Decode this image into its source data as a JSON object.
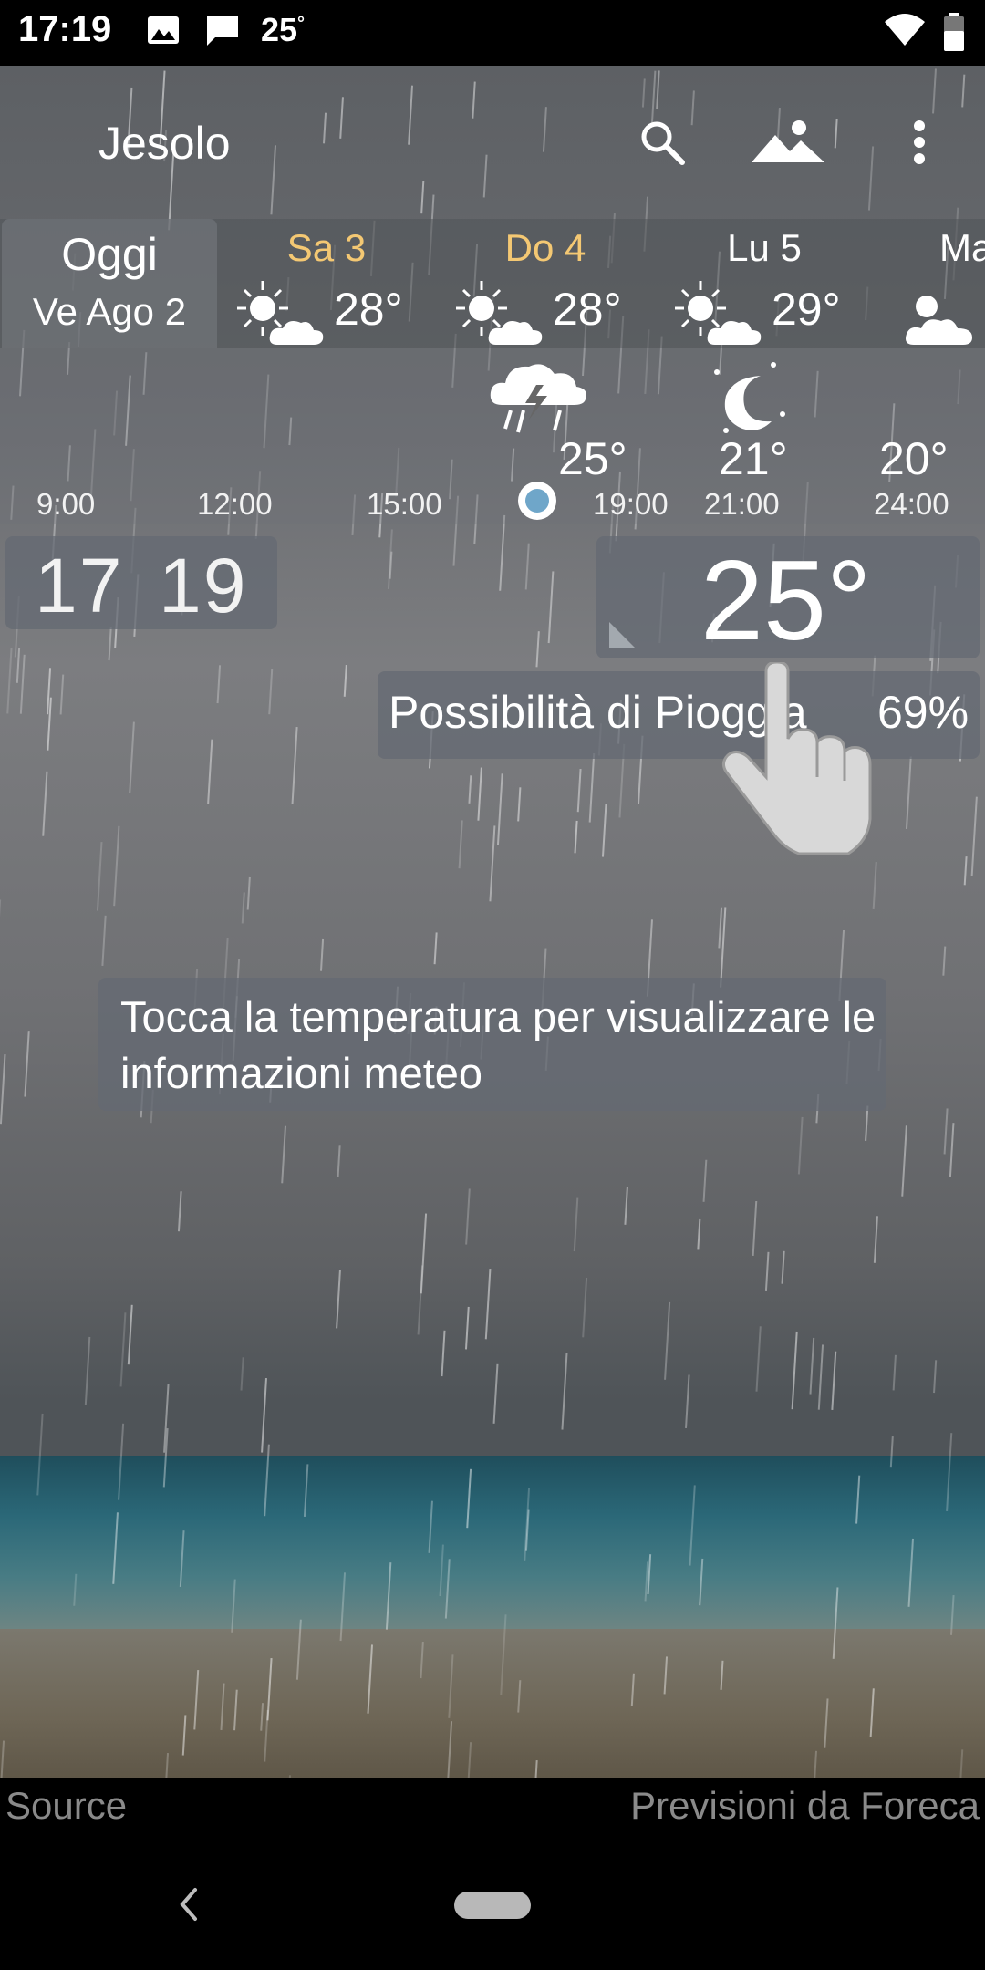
{
  "status_bar": {
    "time": "17:19",
    "temp": "25",
    "temp_degree": "°",
    "icons": [
      "image-icon",
      "message-icon",
      "wifi-icon",
      "battery-icon"
    ]
  },
  "header": {
    "city": "Jesolo",
    "icons": [
      "search-icon",
      "landscape-icon",
      "more-vert-icon"
    ]
  },
  "days": {
    "today": {
      "label": "Oggi",
      "date": "Ve Ago 2"
    },
    "items": [
      {
        "name": "Sa 3",
        "temp": "28°",
        "icon": "partly-sunny-icon",
        "weekend": true
      },
      {
        "name": "Do 4",
        "temp": "28°",
        "icon": "partly-sunny-icon",
        "weekend": true
      },
      {
        "name": "Lu 5",
        "temp": "29°",
        "icon": "partly-sunny-icon",
        "weekend": false
      },
      {
        "name": "Ma",
        "temp": "",
        "icon": "partly-sunny-icon",
        "weekend": false
      }
    ]
  },
  "hourly": {
    "hours": [
      "9:00",
      "12:00",
      "15:00",
      "19:00",
      "21:00",
      "24:00"
    ],
    "temps": [
      "25°",
      "21°",
      "20°"
    ],
    "icons": [
      "thunderstorm-icon",
      "clear-night-icon"
    ]
  },
  "clock": {
    "hours": "17",
    "minutes": "19"
  },
  "current": {
    "temp": "25°"
  },
  "precip": {
    "label": "Possibilità di Pioggia",
    "value": "69%"
  },
  "hint": {
    "text": "Tocca la temperatura per visualizzare le informazioni meteo"
  },
  "footer": {
    "source": "Source",
    "provider": "Previsioni da Foreca"
  },
  "colors": {
    "weekend_day": "#f4c873",
    "now_dot": "#6fa6c9"
  }
}
